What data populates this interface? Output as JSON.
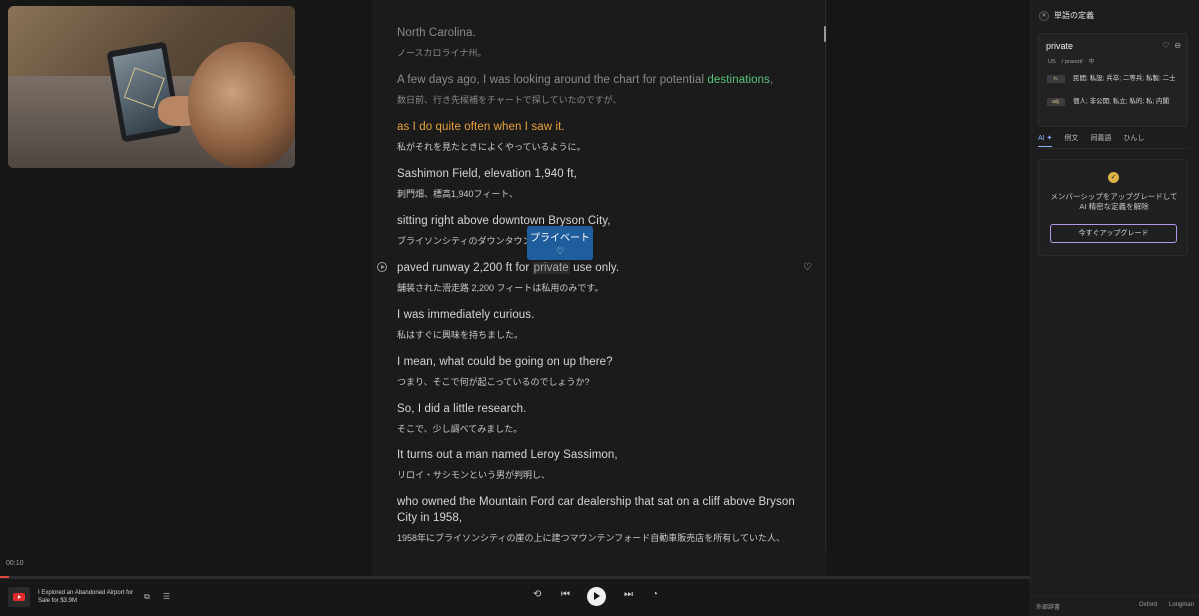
{
  "player": {
    "timecode": "00:10",
    "track_title": "I Explored an Abandoned Airport for Sale for $3.9M",
    "progress_percent": 0.9
  },
  "transcript": [
    {
      "en": "North Carolina.",
      "jp": "ノースカロライナ州。",
      "state": "dim"
    },
    {
      "en_parts": [
        "A few days ago, I was looking around the chart for potential ",
        "destinations",
        ","
      ],
      "jp": "数日前、行き先候補をチャートで探していたのですが、",
      "state": "dim"
    },
    {
      "en": "as I do quite often when I saw it.",
      "jp": "私がそれを見たときによくやっているように。",
      "state": "active"
    },
    {
      "en": "Sashimon Field, elevation 1,940 ft,",
      "jp": "刺門畑、標高1,940フィート、",
      "state": "normal"
    },
    {
      "en": "sitting right above downtown Bryson City,",
      "jp": "ブライソンシティのダウンタウン",
      "state": "normal"
    },
    {
      "en_parts": [
        "paved runway 2,200 ft for ",
        "private",
        " use only."
      ],
      "jp": "舗装された滑走路 2,200 フィートは私用のみです。",
      "state": "normal"
    },
    {
      "en": "I was immediately curious.",
      "jp": "私はすぐに興味を持ちました。",
      "state": "normal"
    },
    {
      "en": "I mean, what could be going on up there?",
      "jp": "つまり、そこで何が起こっているのでしょうか?",
      "state": "normal"
    },
    {
      "en": "So, I did a little research.",
      "jp": "そこで、少し調べてみました。",
      "state": "normal"
    },
    {
      "en": "It turns out a man named Leroy Sassimon,",
      "jp": "リロイ・サシモンという男が判明し、",
      "state": "normal"
    },
    {
      "en_l1": "who owned the Mountain Ford car dealership that sat on a cliff above Bryson",
      "en_l2": "City in 1958,",
      "jp": "1958年にブライソンシティの崖の上に建つマウンテンフォード自動車販売店を所有していた人、",
      "state": "normal"
    }
  ],
  "popup": {
    "word": "プライベート",
    "icon": "heart-icon"
  },
  "panel": {
    "title": "単語の定義",
    "word": "private",
    "region": "US",
    "ipa": "/ˈpraɪvɪt/",
    "speaker": "中",
    "defs": [
      {
        "tag": "n.",
        "text": "民間; 私設; 兵卒; 二等兵; 私製; 二士"
      },
      {
        "tag": "adj.",
        "text": "個人; 非公開; 私立; 私的; 私; 内閣"
      }
    ],
    "tabs": [
      "AI ✦",
      "例文",
      "同義語",
      "ひんし"
    ],
    "ai_badge": "✓",
    "ai_text": "メンバーシップをアップグレードして AI 精密な定義を解除",
    "upgrade_label": "今すぐアップグレード",
    "footer_left": "外部辞書",
    "footer_oxford": "Oxford",
    "footer_longman": "Longman"
  }
}
